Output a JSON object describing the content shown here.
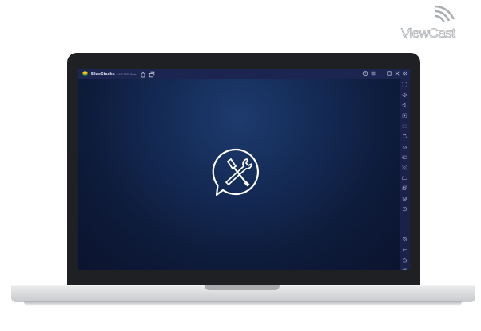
{
  "watermark": {
    "text": "ViewCast",
    "icon": "signal-waves-icon"
  },
  "window": {
    "app_name": "BlueStacks",
    "version": "5.0.0.7228 Beta",
    "left_icons": [
      "home-icon",
      "multi-instance-icon"
    ],
    "right_icons": [
      "help-icon",
      "menu-icon",
      "minimize-icon",
      "restore-icon",
      "close-icon",
      "collapse-sidebar-icon"
    ]
  },
  "content": {
    "center_icon": "tools-wrench-screwdriver-icon"
  },
  "sidebar": {
    "top_icons": [
      "fullscreen-icon",
      "volume-up-icon",
      "volume-down-icon",
      "media-icon",
      "keyboard-icon",
      "rotate-icon",
      "shake-icon",
      "gamepad-icon",
      "screenshot-icon",
      "folder-icon",
      "multi-instance-sync-icon",
      "eco-mode-icon",
      "macro-icon"
    ],
    "bottom_icons": [
      "settings-icon",
      "back-icon",
      "home-icon",
      "recent-apps-icon"
    ]
  },
  "colors": {
    "titlebar": "#1c2550",
    "content_bg": "#142a55",
    "sidebar": "#1a2249",
    "lid": "#1f2023"
  }
}
